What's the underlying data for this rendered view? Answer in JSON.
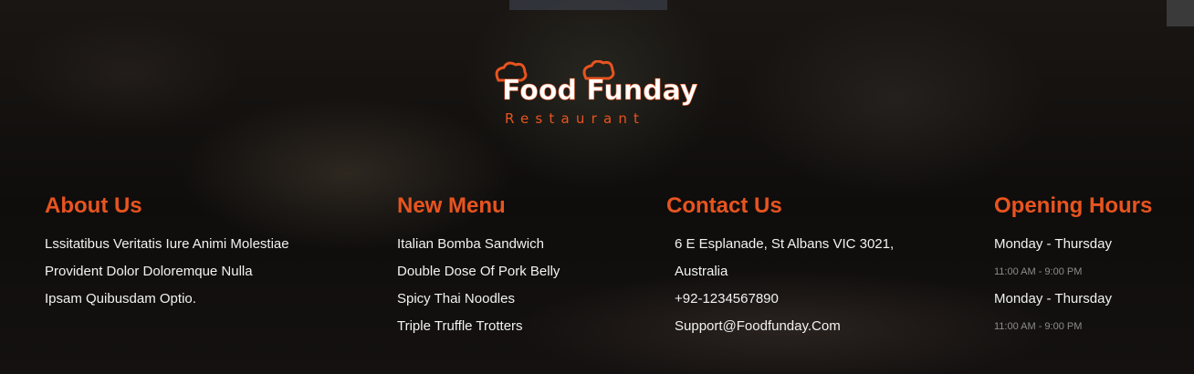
{
  "brand": {
    "name": "Food Funday",
    "tagline": "Restaurant",
    "accent_color": "#e8541f"
  },
  "about": {
    "heading": "About Us",
    "lines": [
      "Lssitatibus Veritatis Iure Animi Molestiae",
      "Provident Dolor Doloremque Nulla",
      "Ipsam Quibusdam Optio."
    ]
  },
  "menu": {
    "heading": "New Menu",
    "items": [
      "Italian Bomba Sandwich",
      "Double Dose Of Pork Belly",
      "Spicy Thai Noodles",
      "Triple Truffle Trotters"
    ]
  },
  "contact": {
    "heading": "Contact Us",
    "address_line1": "6 E Esplanade, St Albans VIC 3021,",
    "address_line2": "Australia",
    "phone": "+92-1234567890",
    "email": "Support@Foodfunday.Com"
  },
  "hours": {
    "heading": "Opening Hours",
    "entries": [
      {
        "days": "Monday - Thursday",
        "time": "11:00 AM - 9:00 PM"
      },
      {
        "days": "Monday - Thursday",
        "time": "11:00 AM - 9:00 PM"
      }
    ]
  }
}
